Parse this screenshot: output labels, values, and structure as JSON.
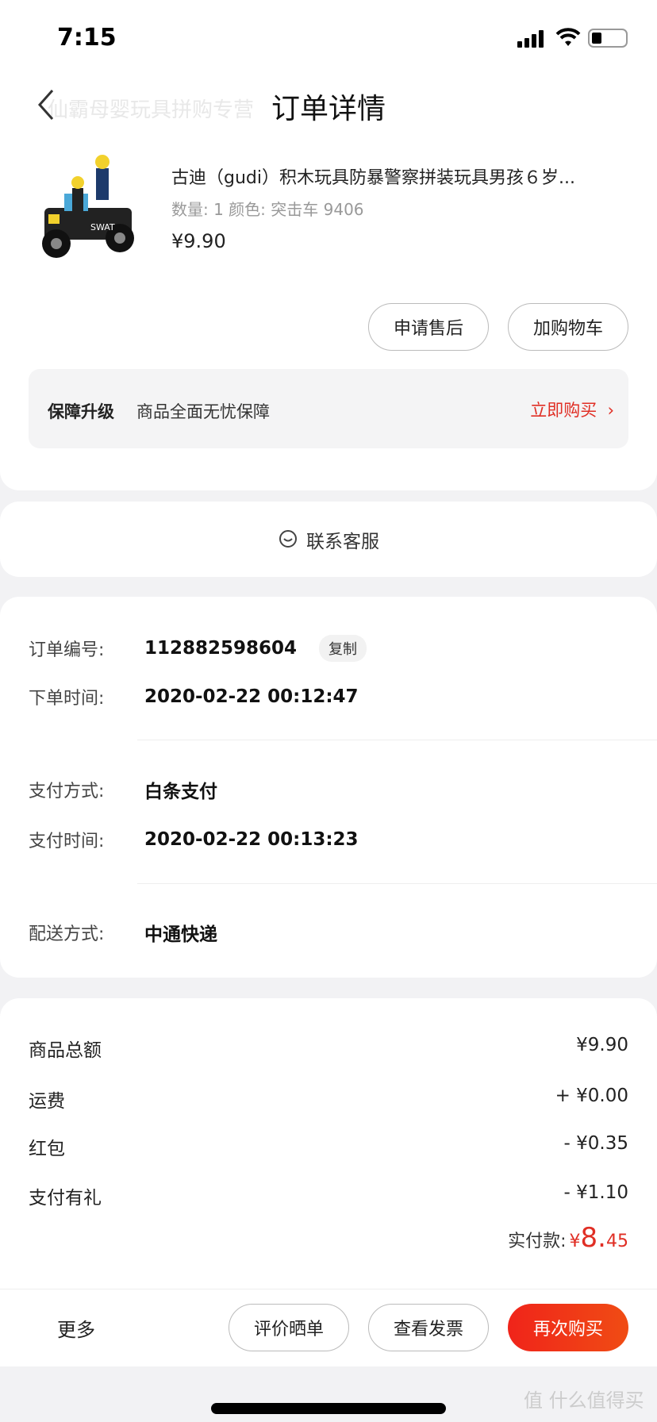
{
  "status_bar": {
    "time": "7:15"
  },
  "nav": {
    "title": "订单详情",
    "store_name_faded": "仙霸母婴玩具拼购专营"
  },
  "product": {
    "name": "古迪（gudi）积木玩具防暴警察拼装玩具男孩６岁...",
    "spec": "数量: 1  颜色: 突击车 9406",
    "price": "¥9.90",
    "image_label": "SWAT"
  },
  "product_actions": {
    "after_sale": "申请售后",
    "add_cart": "加购物车"
  },
  "protection": {
    "label": "保障升级",
    "desc": "商品全面无忧保障",
    "action": "立即购买",
    "chevron": "›"
  },
  "service": {
    "label": "联系客服",
    "icon": "chat-smile-icon"
  },
  "order_info": {
    "order_no_label": "订单编号:",
    "order_no": "112882598604",
    "copy": "复制",
    "order_time_label": "下单时间:",
    "order_time": "2020-02-22 00:12:47",
    "pay_method_label": "支付方式:",
    "pay_method": "白条支付",
    "pay_time_label": "支付时间:",
    "pay_time": "2020-02-22 00:13:23",
    "delivery_label": "配送方式:",
    "delivery": "中通快递"
  },
  "fees": [
    {
      "label": "商品总额",
      "value": "¥9.90"
    },
    {
      "label": "运费",
      "value": "+ ¥0.00"
    },
    {
      "label": "红包",
      "value": "- ¥0.35"
    },
    {
      "label": "支付有礼",
      "value": "- ¥1.10"
    }
  ],
  "total": {
    "label": "实付款:",
    "currency": "¥",
    "integer": "8.",
    "decimal": "45"
  },
  "bottom_bar": {
    "more": "更多",
    "review": "评价晒单",
    "invoice": "查看发票",
    "rebuy": "再次购买"
  },
  "watermark": "值 什么值得买",
  "colors": {
    "accent": "#e02e24",
    "background": "#f2f2f4"
  }
}
